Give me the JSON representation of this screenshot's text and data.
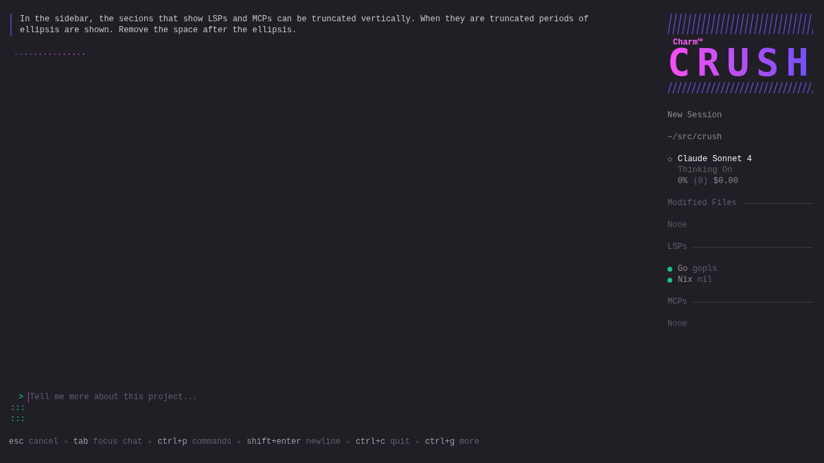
{
  "chat": {
    "messages": [
      {
        "text": "In the sidebar, the secions that show LSPs and MCPs can be truncated vertically. When they are truncated periods of ellipsis are shown. Remove the space after the ellipsis."
      }
    ],
    "loading": "..............."
  },
  "prompt": {
    "marker": ">",
    "placeholder": "Tell me more about this project...",
    "continuation": [
      ":::",
      ":::"
    ]
  },
  "help": [
    {
      "key": "esc",
      "desc": "cancel"
    },
    {
      "key": "tab",
      "desc": "focus chat"
    },
    {
      "key": "ctrl+p",
      "desc": "commands"
    },
    {
      "key": "shift+enter",
      "desc": "newline"
    },
    {
      "key": "ctrl+c",
      "desc": "quit"
    },
    {
      "key": "ctrl+g",
      "desc": "more"
    }
  ],
  "sidebar": {
    "logo": {
      "brand": "Charm™",
      "name": "CRUSH"
    },
    "session": "New Session",
    "path": "~/src/crush",
    "model": {
      "name": "Claude Sonnet 4",
      "thinking": "Thinking On",
      "percent": "0%",
      "tokens": "(0)",
      "cost": "$0.00"
    },
    "sections": [
      {
        "title": "Modified Files",
        "empty": "None"
      },
      {
        "title": "LSPs",
        "items": [
          {
            "name": "Go",
            "detail": "gopls",
            "color": "#12c78f"
          },
          {
            "name": "Nix",
            "detail": "nil",
            "color": "#12c78f"
          }
        ]
      },
      {
        "title": "MCPs",
        "empty": "None"
      }
    ]
  }
}
